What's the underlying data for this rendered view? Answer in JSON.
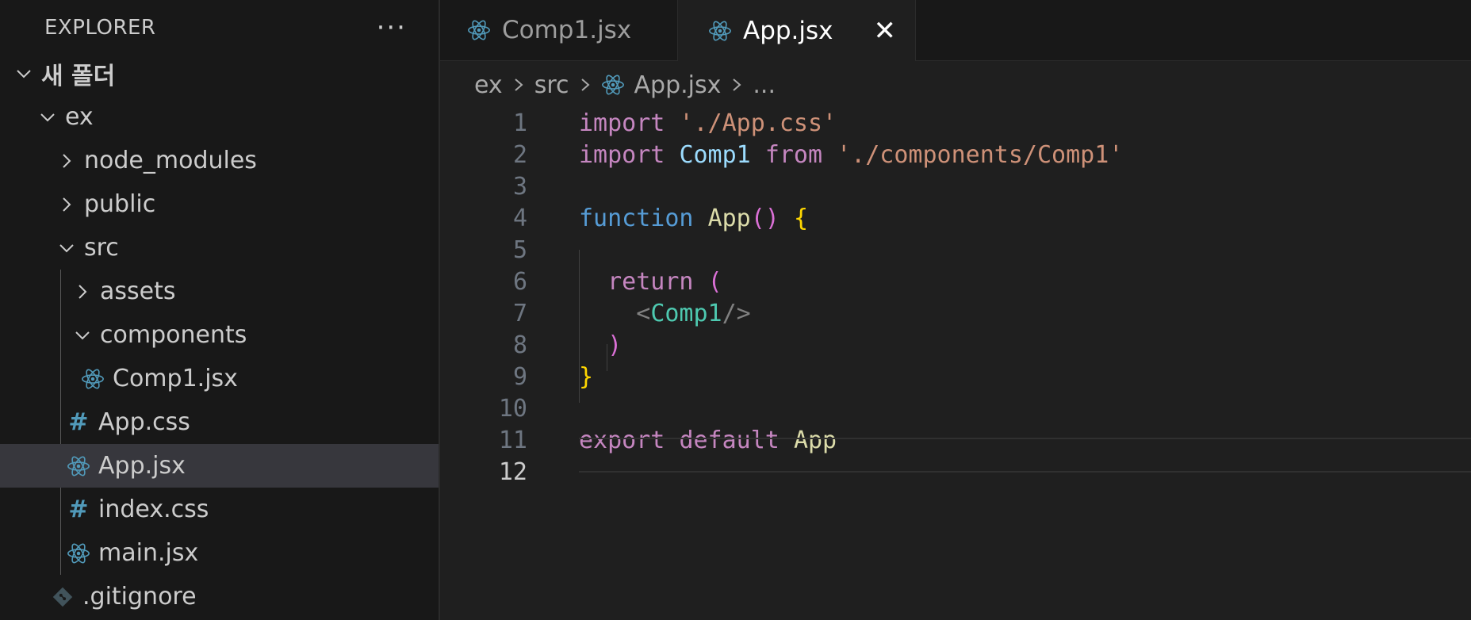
{
  "explorer": {
    "title": "EXPLORER",
    "more": "···",
    "items": [
      {
        "label": "새 폴더",
        "type": "folder-open"
      },
      {
        "label": "ex",
        "type": "folder-open"
      },
      {
        "label": "node_modules",
        "type": "folder-closed"
      },
      {
        "label": "public",
        "type": "folder-closed"
      },
      {
        "label": "src",
        "type": "folder-open"
      },
      {
        "label": "assets",
        "type": "folder-closed"
      },
      {
        "label": "components",
        "type": "folder-open"
      },
      {
        "label": "Comp1.jsx",
        "type": "react-file",
        "icon": "react-icon"
      },
      {
        "label": "App.css",
        "type": "css-file",
        "icon": "hash-icon"
      },
      {
        "label": "App.jsx",
        "type": "react-file",
        "icon": "react-icon",
        "selected": true
      },
      {
        "label": "index.css",
        "type": "css-file",
        "icon": "hash-icon"
      },
      {
        "label": "main.jsx",
        "type": "react-file",
        "icon": "react-icon"
      },
      {
        "label": ".gitignore",
        "type": "git-file",
        "icon": "git-icon"
      }
    ]
  },
  "tabs": [
    {
      "label": "Comp1.jsx",
      "active": false
    },
    {
      "label": "App.jsx",
      "active": true,
      "close": "✕"
    }
  ],
  "breadcrumb": {
    "parts": [
      "ex",
      "src",
      "App.jsx",
      "..."
    ]
  },
  "editor": {
    "line_numbers": [
      "1",
      "2",
      "3",
      "4",
      "5",
      "6",
      "7",
      "8",
      "9",
      "10",
      "11",
      "12"
    ],
    "current_line": "12",
    "lines": {
      "l1": {
        "kw": "import",
        "str": "'./App.css'"
      },
      "l2": {
        "kw": "import",
        "name": "Comp1",
        "from": "from",
        "str": "'./components/Comp1'"
      },
      "l4": {
        "kw": "function",
        "name": "App",
        "parens": "()",
        "brace": "{"
      },
      "l6": {
        "kw": "return",
        "paren": "("
      },
      "l7": {
        "open": "<",
        "tag": "Comp1",
        "close": "/>"
      },
      "l8": {
        "paren": ")"
      },
      "l9": {
        "brace": "}"
      },
      "l11": {
        "kw1": "export",
        "kw2": "default",
        "name": "App"
      }
    }
  },
  "colors": {
    "background": "#1f1f1f",
    "sidebar": "#181818",
    "selected_row": "#37373d",
    "react_icon": "#519aba",
    "keyword_purple": "#c586c0",
    "keyword_blue": "#569cd6",
    "string": "#ce9178"
  }
}
